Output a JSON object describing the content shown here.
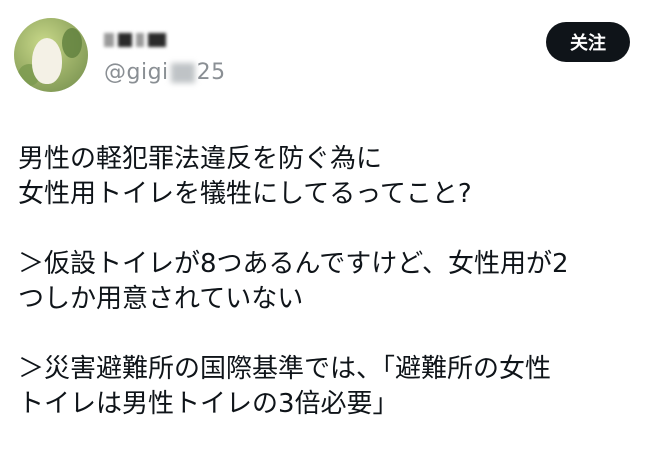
{
  "user": {
    "display_name": "",
    "handle_prefix": "@gigi",
    "handle_suffix": "25",
    "avatar_icon": "bird-avatar-icon"
  },
  "follow_button": {
    "label": "关注"
  },
  "tweet": {
    "lines": [
      "男性の軽犯罪法違反を防ぐ為に",
      "女性用トイレを犠牲にしてるってこと?",
      "",
      "＞仮設トイレが8つあるんですけど、女性用が2",
      "つしか用意されていない",
      "",
      "＞災害避難所の国際基準では、「避難所の女性",
      "トイレは男性トイレの3倍必要」"
    ]
  },
  "colors": {
    "text": "#0f1419",
    "muted": "#8a8f94",
    "button_bg": "#0f1419",
    "button_text": "#ffffff"
  }
}
